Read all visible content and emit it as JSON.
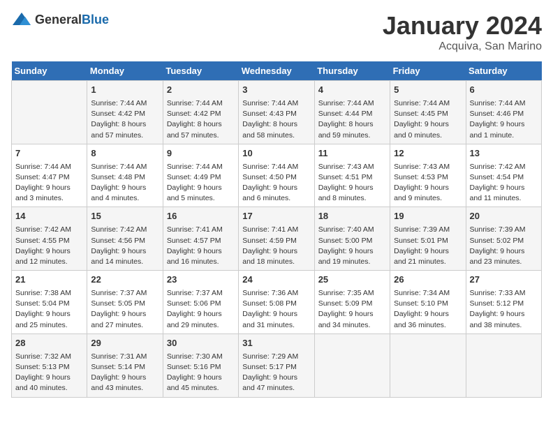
{
  "header": {
    "logo_general": "General",
    "logo_blue": "Blue",
    "month": "January 2024",
    "location": "Acquiva, San Marino"
  },
  "days_of_week": [
    "Sunday",
    "Monday",
    "Tuesday",
    "Wednesday",
    "Thursday",
    "Friday",
    "Saturday"
  ],
  "weeks": [
    [
      {
        "day": "",
        "info": ""
      },
      {
        "day": "1",
        "info": "Sunrise: 7:44 AM\nSunset: 4:42 PM\nDaylight: 8 hours\nand 57 minutes."
      },
      {
        "day": "2",
        "info": "Sunrise: 7:44 AM\nSunset: 4:42 PM\nDaylight: 8 hours\nand 57 minutes."
      },
      {
        "day": "3",
        "info": "Sunrise: 7:44 AM\nSunset: 4:43 PM\nDaylight: 8 hours\nand 58 minutes."
      },
      {
        "day": "4",
        "info": "Sunrise: 7:44 AM\nSunset: 4:44 PM\nDaylight: 8 hours\nand 59 minutes."
      },
      {
        "day": "5",
        "info": "Sunrise: 7:44 AM\nSunset: 4:45 PM\nDaylight: 9 hours\nand 0 minutes."
      },
      {
        "day": "6",
        "info": "Sunrise: 7:44 AM\nSunset: 4:46 PM\nDaylight: 9 hours\nand 1 minute."
      }
    ],
    [
      {
        "day": "7",
        "info": "Sunrise: 7:44 AM\nSunset: 4:47 PM\nDaylight: 9 hours\nand 3 minutes."
      },
      {
        "day": "8",
        "info": "Sunrise: 7:44 AM\nSunset: 4:48 PM\nDaylight: 9 hours\nand 4 minutes."
      },
      {
        "day": "9",
        "info": "Sunrise: 7:44 AM\nSunset: 4:49 PM\nDaylight: 9 hours\nand 5 minutes."
      },
      {
        "day": "10",
        "info": "Sunrise: 7:44 AM\nSunset: 4:50 PM\nDaylight: 9 hours\nand 6 minutes."
      },
      {
        "day": "11",
        "info": "Sunrise: 7:43 AM\nSunset: 4:51 PM\nDaylight: 9 hours\nand 8 minutes."
      },
      {
        "day": "12",
        "info": "Sunrise: 7:43 AM\nSunset: 4:53 PM\nDaylight: 9 hours\nand 9 minutes."
      },
      {
        "day": "13",
        "info": "Sunrise: 7:42 AM\nSunset: 4:54 PM\nDaylight: 9 hours\nand 11 minutes."
      }
    ],
    [
      {
        "day": "14",
        "info": "Sunrise: 7:42 AM\nSunset: 4:55 PM\nDaylight: 9 hours\nand 12 minutes."
      },
      {
        "day": "15",
        "info": "Sunrise: 7:42 AM\nSunset: 4:56 PM\nDaylight: 9 hours\nand 14 minutes."
      },
      {
        "day": "16",
        "info": "Sunrise: 7:41 AM\nSunset: 4:57 PM\nDaylight: 9 hours\nand 16 minutes."
      },
      {
        "day": "17",
        "info": "Sunrise: 7:41 AM\nSunset: 4:59 PM\nDaylight: 9 hours\nand 18 minutes."
      },
      {
        "day": "18",
        "info": "Sunrise: 7:40 AM\nSunset: 5:00 PM\nDaylight: 9 hours\nand 19 minutes."
      },
      {
        "day": "19",
        "info": "Sunrise: 7:39 AM\nSunset: 5:01 PM\nDaylight: 9 hours\nand 21 minutes."
      },
      {
        "day": "20",
        "info": "Sunrise: 7:39 AM\nSunset: 5:02 PM\nDaylight: 9 hours\nand 23 minutes."
      }
    ],
    [
      {
        "day": "21",
        "info": "Sunrise: 7:38 AM\nSunset: 5:04 PM\nDaylight: 9 hours\nand 25 minutes."
      },
      {
        "day": "22",
        "info": "Sunrise: 7:37 AM\nSunset: 5:05 PM\nDaylight: 9 hours\nand 27 minutes."
      },
      {
        "day": "23",
        "info": "Sunrise: 7:37 AM\nSunset: 5:06 PM\nDaylight: 9 hours\nand 29 minutes."
      },
      {
        "day": "24",
        "info": "Sunrise: 7:36 AM\nSunset: 5:08 PM\nDaylight: 9 hours\nand 31 minutes."
      },
      {
        "day": "25",
        "info": "Sunrise: 7:35 AM\nSunset: 5:09 PM\nDaylight: 9 hours\nand 34 minutes."
      },
      {
        "day": "26",
        "info": "Sunrise: 7:34 AM\nSunset: 5:10 PM\nDaylight: 9 hours\nand 36 minutes."
      },
      {
        "day": "27",
        "info": "Sunrise: 7:33 AM\nSunset: 5:12 PM\nDaylight: 9 hours\nand 38 minutes."
      }
    ],
    [
      {
        "day": "28",
        "info": "Sunrise: 7:32 AM\nSunset: 5:13 PM\nDaylight: 9 hours\nand 40 minutes."
      },
      {
        "day": "29",
        "info": "Sunrise: 7:31 AM\nSunset: 5:14 PM\nDaylight: 9 hours\nand 43 minutes."
      },
      {
        "day": "30",
        "info": "Sunrise: 7:30 AM\nSunset: 5:16 PM\nDaylight: 9 hours\nand 45 minutes."
      },
      {
        "day": "31",
        "info": "Sunrise: 7:29 AM\nSunset: 5:17 PM\nDaylight: 9 hours\nand 47 minutes."
      },
      {
        "day": "",
        "info": ""
      },
      {
        "day": "",
        "info": ""
      },
      {
        "day": "",
        "info": ""
      }
    ]
  ]
}
